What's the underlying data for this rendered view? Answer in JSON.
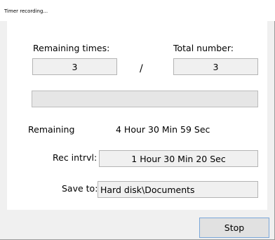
{
  "window": {
    "title": "Timer recording..."
  },
  "remaining_times": {
    "label": "Remaining times:",
    "value": "3"
  },
  "separator": "/",
  "total_number": {
    "label": "Total number:",
    "value": "3"
  },
  "progress": {
    "fraction": 0
  },
  "remaining": {
    "label": "Remaining",
    "value": "4 Hour 30 Min 59 Sec"
  },
  "rec_interval": {
    "label": "Rec intrvl:",
    "value": "1 Hour 30 Min 20 Sec"
  },
  "save_to": {
    "label": "Save to:",
    "value": "Hard disk\\Documents"
  },
  "buttons": {
    "stop_label": "Stop"
  }
}
